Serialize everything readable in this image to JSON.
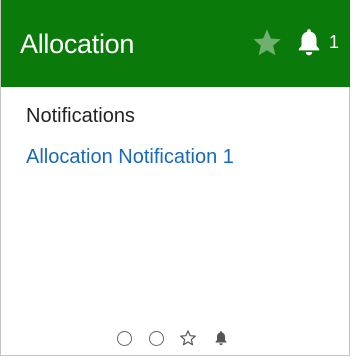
{
  "header": {
    "title": "Allocation",
    "star_icon": "star-icon",
    "bell_icon": "bell-icon",
    "notification_count": "1",
    "background_color": "#0a7a0a",
    "star_color": "#6fb06f"
  },
  "body": {
    "section_label": "Notifications",
    "notifications": [
      {
        "label": "Allocation Notification 1"
      }
    ],
    "link_color": "#1a69b8"
  },
  "pager": {
    "items": [
      {
        "icon": "circle-icon"
      },
      {
        "icon": "circle-icon"
      },
      {
        "icon": "star-outline-icon"
      },
      {
        "icon": "bell-icon"
      }
    ]
  }
}
